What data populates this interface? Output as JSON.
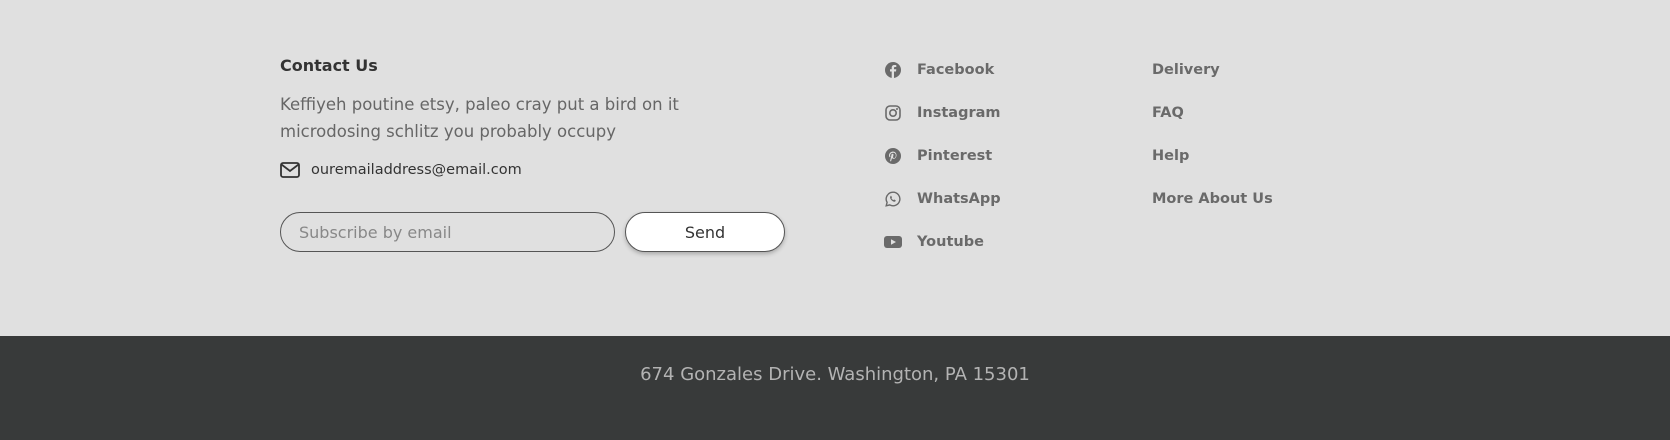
{
  "contact": {
    "title": "Contact Us",
    "description": "Keffiyeh poutine etsy, paleo cray put a bird on it microdosing schlitz you probably occupy",
    "email": "ouremailaddress@email.com",
    "mail_icon": "envelope-icon"
  },
  "subscribe": {
    "placeholder": "Subscribe by email",
    "value": "",
    "button_label": "Send"
  },
  "social": [
    {
      "label": "Facebook",
      "icon": "facebook-icon"
    },
    {
      "label": "Instagram",
      "icon": "instagram-icon"
    },
    {
      "label": "Pinterest",
      "icon": "pinterest-icon"
    },
    {
      "label": "WhatsApp",
      "icon": "whatsapp-icon"
    },
    {
      "label": "Youtube",
      "icon": "youtube-icon"
    }
  ],
  "links": [
    {
      "label": "Delivery"
    },
    {
      "label": "FAQ"
    },
    {
      "label": "Help"
    },
    {
      "label": "More About Us"
    }
  ],
  "footer": {
    "address": "674 Gonzales Drive. Washington, PA 15301"
  },
  "colors": {
    "top_background": "#e0e0e0",
    "bottom_background": "#383a3a",
    "icon_color": "#6a6a6a"
  }
}
